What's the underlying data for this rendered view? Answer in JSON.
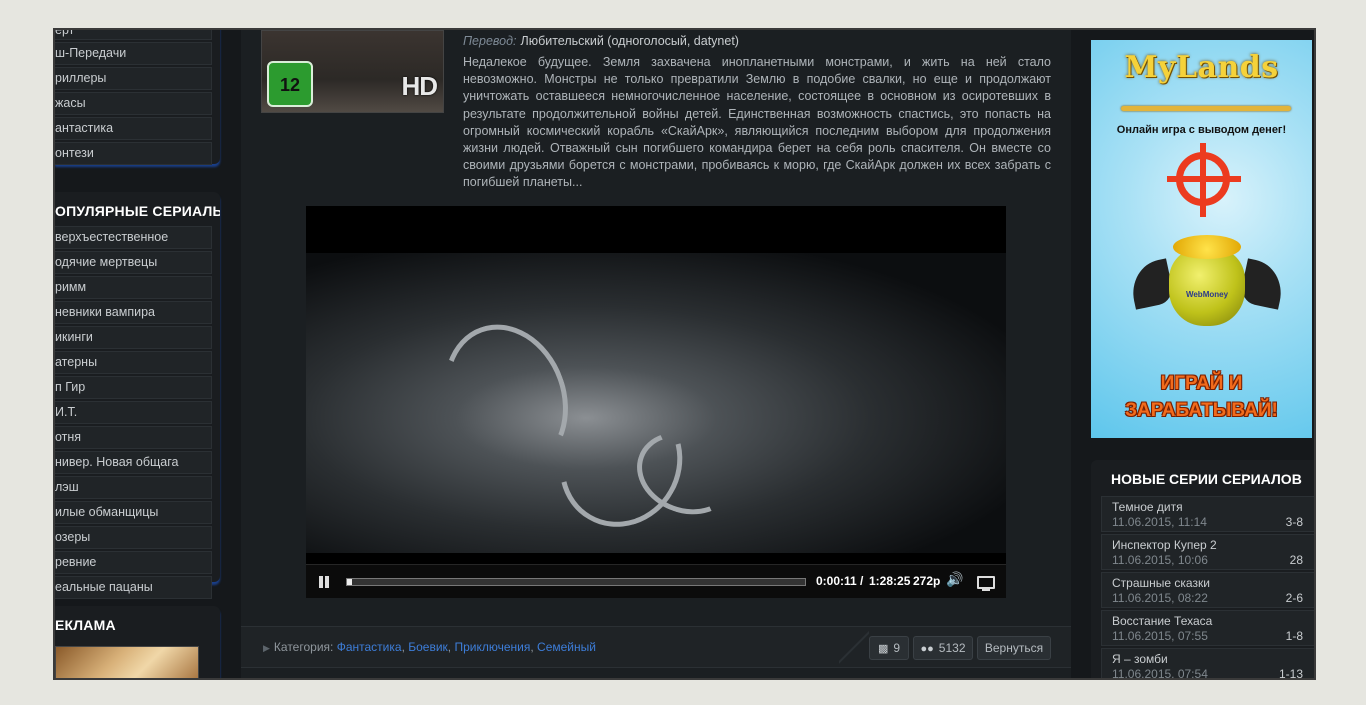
{
  "left": {
    "top_items": [
      "ерт",
      "ш-Передачи",
      "риллеры",
      "жасы",
      "антастика",
      "онтези"
    ],
    "popular": {
      "title": "ОПУЛЯРНЫЕ СЕРИАЛЫ",
      "items": [
        "верхъестественное",
        "одячие мертвецы",
        "римм",
        "невники вампира",
        "икинги",
        "атерны",
        "п Гир",
        "И.Т.",
        "отня",
        "нивер. Новая общага",
        "лэш",
        "илые обманщицы",
        "озеры",
        "ревние",
        "еальные пацаны"
      ]
    },
    "ads": {
      "title": "ЕКЛАМА"
    }
  },
  "movie": {
    "poster": {
      "rating": "12",
      "hd": "HD"
    },
    "translation_label": "Перевод:",
    "translation_value": "Любительский (одноголосый, datynet)",
    "description": "Недалекое будущее. Земля захвачена инопланетными монстрами, и жить на ней стало невозможно. Монстры не только превратили Землю в подобие свалки, но еще и продолжают уничтожать оставшееся немногочисленное население, состоящее в основном из осиротевших в результате продолжительной войны детей. Единственная возможность спастись, это попасть на огромный космический корабль «СкайАрк», являющийся последним выбором для продолжения жизни людей. Отважный сын погибшего командира берет на себя роль спасителя. Он вместе со своими друзьями борется с монстрами, пробиваясь к морю, где СкайАрк должен их всех забрать с погибшей планеты..."
  },
  "player": {
    "current_time": "0:00:11",
    "separator": "/",
    "total_time": "1:28:25",
    "quality": "272p",
    "progress": 0.005
  },
  "footer": {
    "category_label": "Категория:",
    "categories": [
      "Фантастика",
      "Боевик",
      "Приключения",
      "Семейный"
    ],
    "comments": "9",
    "views": "5132",
    "back_label": "Вернуться"
  },
  "right": {
    "banner": {
      "logo": "MyLands",
      "tagline": "Онлайн игра с выводом денег!",
      "webmoney": "WebMoney",
      "cta_line1": "ИГРАЙ И",
      "cta_line2": "ЗАРАБАТЫВАЙ!"
    },
    "new_series": {
      "title": "НОВЫЕ СЕРИИ СЕРИАЛОВ",
      "items": [
        {
          "name": "Темное дитя",
          "date": "11.06.2015, 11:14",
          "ep": "3-8"
        },
        {
          "name": "Инспектор Купер 2",
          "date": "11.06.2015, 10:06",
          "ep": "28"
        },
        {
          "name": "Страшные сказки",
          "date": "11.06.2015, 08:22",
          "ep": "2-6"
        },
        {
          "name": "Восстание Техаса",
          "date": "11.06.2015, 07:55",
          "ep": "1-8"
        },
        {
          "name": "Я – зомби",
          "date": "11.06.2015, 07:54",
          "ep": "1-13"
        }
      ]
    }
  },
  "colors": {
    "link": "#3d7dd8",
    "accent_glow": "#1a3f8a",
    "banner_cta": "#f26b1c"
  }
}
